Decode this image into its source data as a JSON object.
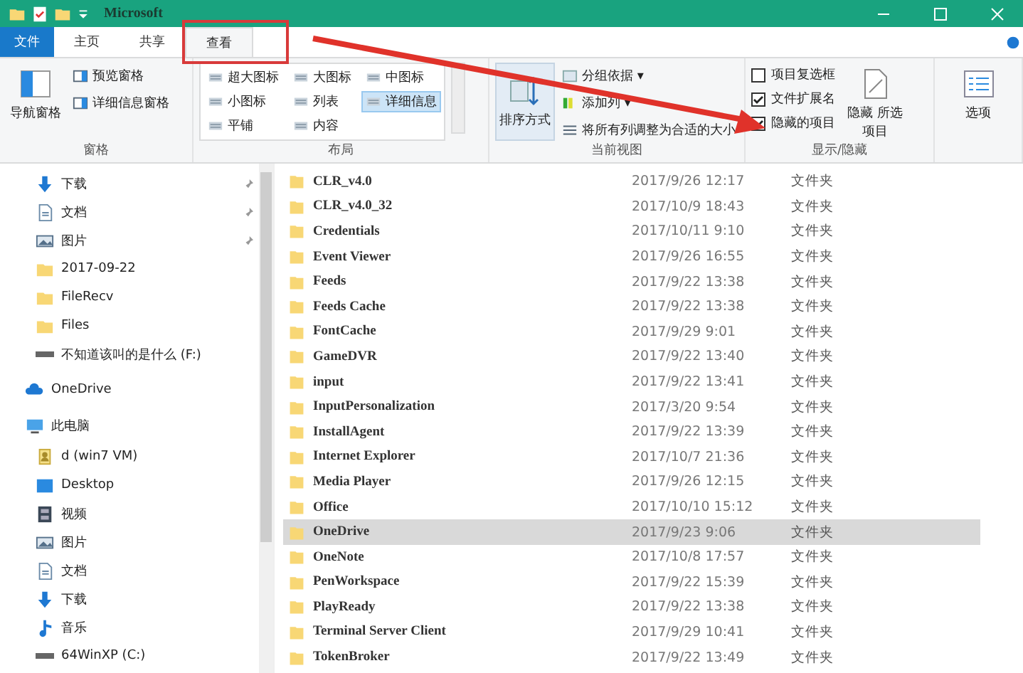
{
  "window": {
    "title": "Microsoft"
  },
  "ribbon_tabs": [
    {
      "label": "文件",
      "kind": "file",
      "selected": false
    },
    {
      "label": "主页",
      "kind": "tab",
      "selected": false
    },
    {
      "label": "共享",
      "kind": "tab",
      "selected": false
    },
    {
      "label": "查看",
      "kind": "tab",
      "selected": true
    }
  ],
  "ribbon": {
    "panes": {
      "label": "窗格",
      "nav_pane": "导航窗格",
      "preview_pane": "预览窗格",
      "details_pane": "详细信息窗格"
    },
    "layout": {
      "label": "布局",
      "options": [
        {
          "label": "超大图标",
          "selected": false
        },
        {
          "label": "大图标",
          "selected": false
        },
        {
          "label": "中图标",
          "selected": false
        },
        {
          "label": "小图标",
          "selected": false
        },
        {
          "label": "列表",
          "selected": false
        },
        {
          "label": "详细信息",
          "selected": true
        },
        {
          "label": "平铺",
          "selected": false
        },
        {
          "label": "内容",
          "selected": false
        }
      ]
    },
    "current_view": {
      "label": "当前视图",
      "sort": "排序方式",
      "group_by": "分组依据 ▾",
      "add_columns": "添加列 ▾",
      "fit_columns": "将所有列调整为合适的大小"
    },
    "show_hide": {
      "label": "显示/隐藏",
      "checkboxes": [
        {
          "label": "项目复选框",
          "checked": false
        },
        {
          "label": "文件扩展名",
          "checked": true
        },
        {
          "label": "隐藏的项目",
          "checked": true
        }
      ],
      "hide_selected": "隐藏 所选项目"
    },
    "options": "选项"
  },
  "sidebar": {
    "quick_access": [
      {
        "label": "下载",
        "kind": "download",
        "pinned": true
      },
      {
        "label": "文档",
        "kind": "document",
        "pinned": true
      },
      {
        "label": "图片",
        "kind": "picture",
        "pinned": true
      },
      {
        "label": "2017-09-22",
        "kind": "folder",
        "pinned": false
      },
      {
        "label": "FileRecv",
        "kind": "folder",
        "pinned": false
      },
      {
        "label": "Files",
        "kind": "folder",
        "pinned": false
      },
      {
        "label": "不知道该叫的是什么 (F:)",
        "kind": "drive",
        "pinned": false
      }
    ],
    "tree": [
      {
        "label": "OneDrive",
        "kind": "cloud"
      },
      {
        "label": "此电脑",
        "kind": "pc",
        "children": [
          {
            "label": "d (win7 VM)",
            "kind": "user"
          },
          {
            "label": "Desktop",
            "kind": "desktop"
          },
          {
            "label": "视频",
            "kind": "video"
          },
          {
            "label": "图片",
            "kind": "picture"
          },
          {
            "label": "文档",
            "kind": "document"
          },
          {
            "label": "下载",
            "kind": "download"
          },
          {
            "label": "音乐",
            "kind": "music"
          },
          {
            "label": "64WinXP  (C:)",
            "kind": "drive"
          }
        ]
      }
    ]
  },
  "files": [
    {
      "name": "CLR_v4.0",
      "date": "2017/9/26 12:17",
      "type": "文件夹",
      "selected": false
    },
    {
      "name": "CLR_v4.0_32",
      "date": "2017/10/9 18:43",
      "type": "文件夹",
      "selected": false
    },
    {
      "name": "Credentials",
      "date": "2017/10/11 9:10",
      "type": "文件夹",
      "selected": false
    },
    {
      "name": "Event Viewer",
      "date": "2017/9/26 16:55",
      "type": "文件夹",
      "selected": false
    },
    {
      "name": "Feeds",
      "date": "2017/9/22 13:38",
      "type": "文件夹",
      "selected": false
    },
    {
      "name": "Feeds Cache",
      "date": "2017/9/22 13:38",
      "type": "文件夹",
      "selected": false
    },
    {
      "name": "FontCache",
      "date": "2017/9/29 9:01",
      "type": "文件夹",
      "selected": false
    },
    {
      "name": "GameDVR",
      "date": "2017/9/22 13:40",
      "type": "文件夹",
      "selected": false
    },
    {
      "name": "input",
      "date": "2017/9/22 13:41",
      "type": "文件夹",
      "selected": false
    },
    {
      "name": "InputPersonalization",
      "date": "2017/3/20 9:54",
      "type": "文件夹",
      "selected": false
    },
    {
      "name": "InstallAgent",
      "date": "2017/9/22 13:39",
      "type": "文件夹",
      "selected": false
    },
    {
      "name": "Internet Explorer",
      "date": "2017/10/7 21:36",
      "type": "文件夹",
      "selected": false
    },
    {
      "name": "Media Player",
      "date": "2017/9/26 12:15",
      "type": "文件夹",
      "selected": false
    },
    {
      "name": "Office",
      "date": "2017/10/10 15:12",
      "type": "文件夹",
      "selected": false
    },
    {
      "name": "OneDrive",
      "date": "2017/9/23 9:06",
      "type": "文件夹",
      "selected": true
    },
    {
      "name": "OneNote",
      "date": "2017/10/8 17:57",
      "type": "文件夹",
      "selected": false
    },
    {
      "name": "PenWorkspace",
      "date": "2017/9/22 15:39",
      "type": "文件夹",
      "selected": false
    },
    {
      "name": "PlayReady",
      "date": "2017/9/22 13:38",
      "type": "文件夹",
      "selected": false
    },
    {
      "name": "Terminal Server Client",
      "date": "2017/9/29 10:41",
      "type": "文件夹",
      "selected": false
    },
    {
      "name": "TokenBroker",
      "date": "2017/9/22 13:49",
      "type": "文件夹",
      "selected": false
    }
  ]
}
